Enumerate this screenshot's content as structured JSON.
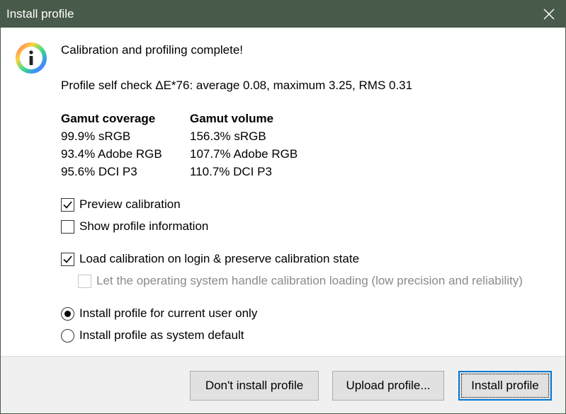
{
  "window": {
    "title": "Install profile"
  },
  "icons": {
    "close": "close-icon",
    "info": "info-icon"
  },
  "main": {
    "headline": "Calibration and profiling complete!",
    "self_check": "Profile self check ΔE*76: average 0.08, maximum 3.25, RMS 0.31",
    "gamut_coverage": {
      "header": "Gamut coverage",
      "rows": [
        "99.9% sRGB",
        "93.4% Adobe RGB",
        "95.6% DCI P3"
      ]
    },
    "gamut_volume": {
      "header": "Gamut volume",
      "rows": [
        "156.3% sRGB",
        "107.7% Adobe RGB",
        "110.7% DCI P3"
      ]
    },
    "options": {
      "preview_calibration": {
        "label": "Preview calibration",
        "checked": true
      },
      "show_profile_info": {
        "label": "Show profile information",
        "checked": false
      },
      "load_calibration": {
        "label": "Load calibration on login & preserve calibration state",
        "checked": true
      },
      "os_handle_loading": {
        "label": "Let the operating system handle calibration loading (low precision and reliability)",
        "checked": false,
        "disabled": true
      }
    },
    "install_scope": {
      "current_user": {
        "label": "Install profile for current user only",
        "selected": true
      },
      "system_default": {
        "label": "Install profile as system default",
        "selected": false
      }
    }
  },
  "footer": {
    "dont_install": "Don't install profile",
    "upload": "Upload profile...",
    "install": "Install profile"
  },
  "colors": {
    "titlebar": "#485a4a",
    "footer": "#f0f0f0",
    "primary_border": "#0078d7"
  }
}
